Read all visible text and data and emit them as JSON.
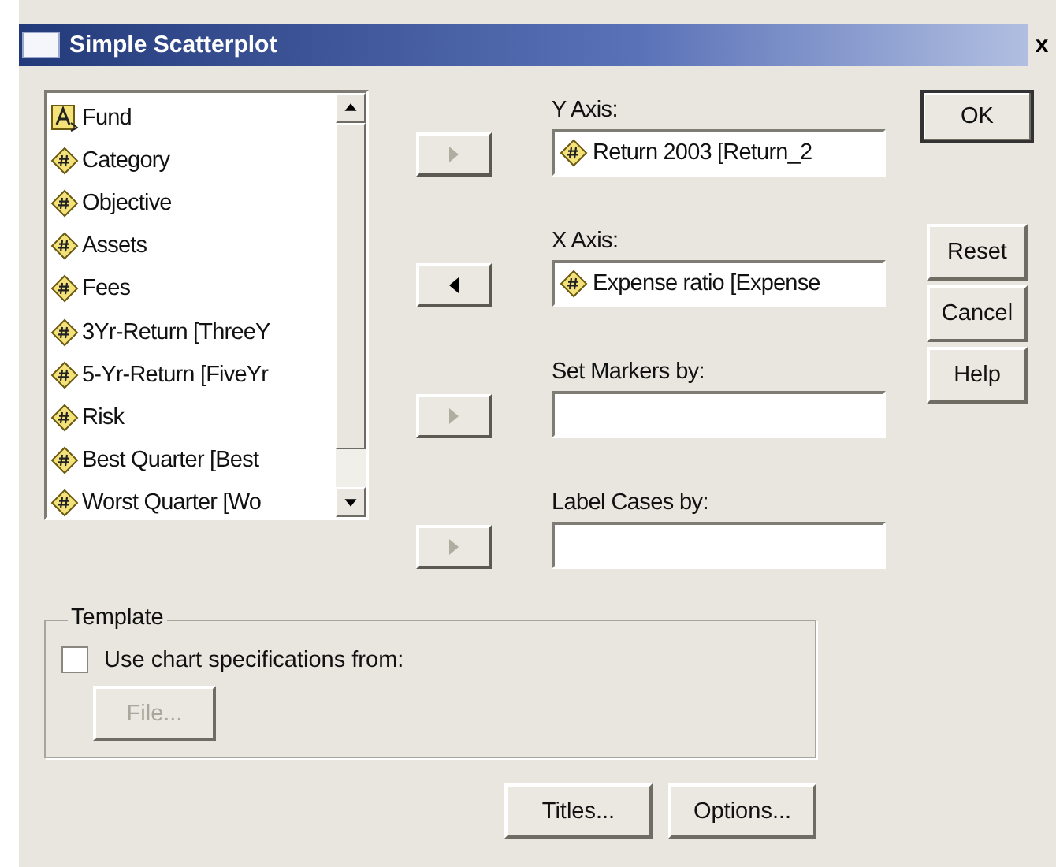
{
  "window": {
    "title": "Simple Scatterplot",
    "close": "x"
  },
  "variables": [
    {
      "label": "Fund",
      "kind": "string"
    },
    {
      "label": "Category",
      "kind": "numeric"
    },
    {
      "label": "Objective",
      "kind": "numeric"
    },
    {
      "label": "Assets",
      "kind": "numeric"
    },
    {
      "label": "Fees",
      "kind": "numeric"
    },
    {
      "label": "3Yr-Return [ThreeY",
      "kind": "numeric"
    },
    {
      "label": "5-Yr-Return [FiveYr",
      "kind": "numeric"
    },
    {
      "label": "Risk",
      "kind": "numeric"
    },
    {
      "label": "Best Quarter [Best",
      "kind": "numeric"
    },
    {
      "label": "Worst Quarter [Wo",
      "kind": "numeric"
    }
  ],
  "targets": [
    {
      "label": "Y Axis:",
      "kind": "right",
      "disabled": true,
      "value": "Return 2003 [Return_2"
    },
    {
      "label": "X Axis:",
      "kind": "left",
      "disabled": false,
      "value": "Expense ratio [Expense"
    },
    {
      "label": "Set Markers by:",
      "kind": "right",
      "disabled": true
    },
    {
      "label": "Label Cases by:",
      "kind": "right",
      "disabled": true
    }
  ],
  "side_buttons": [
    {
      "label": "OK",
      "default": true
    },
    {
      "label": "Reset",
      "default": false
    },
    {
      "label": "Cancel",
      "default": false
    },
    {
      "label": "Help",
      "default": false
    }
  ],
  "template": {
    "title": "Template",
    "checkbox": {
      "label": "Use chart specifications from:",
      "checked": false
    },
    "file_button": {
      "label": "File...",
      "disabled": true
    }
  },
  "bottom_buttons": [
    "Titles...",
    "Options..."
  ]
}
